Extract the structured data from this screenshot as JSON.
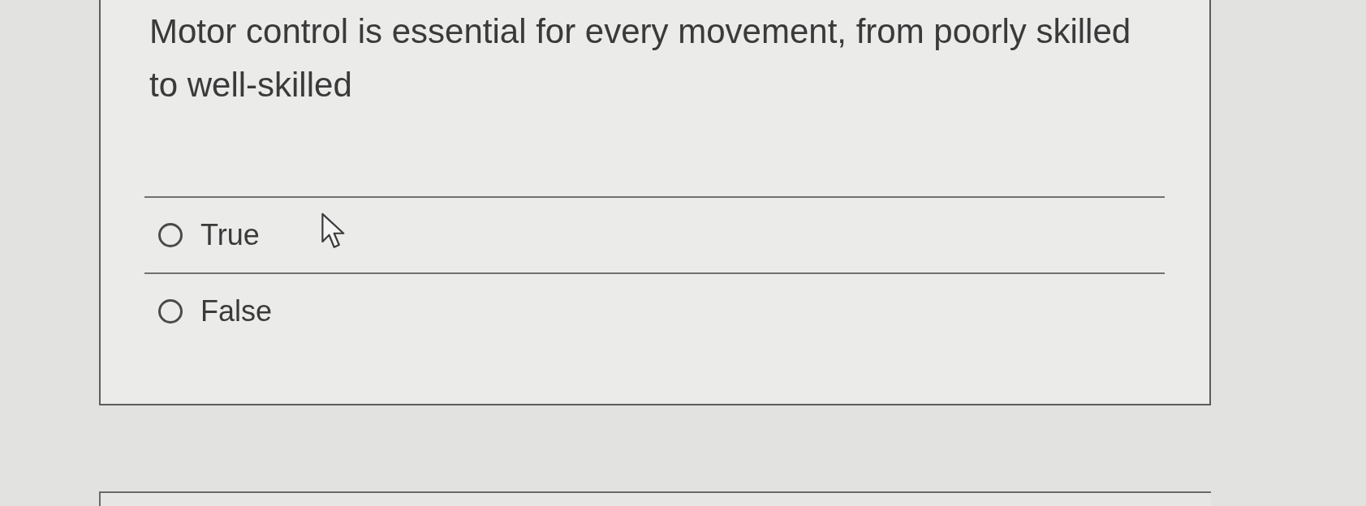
{
  "question": {
    "text": "Motor control is essential for every movement, from poorly skilled to well-skilled"
  },
  "options": [
    {
      "label": "True",
      "selected": false
    },
    {
      "label": "False",
      "selected": false
    }
  ]
}
